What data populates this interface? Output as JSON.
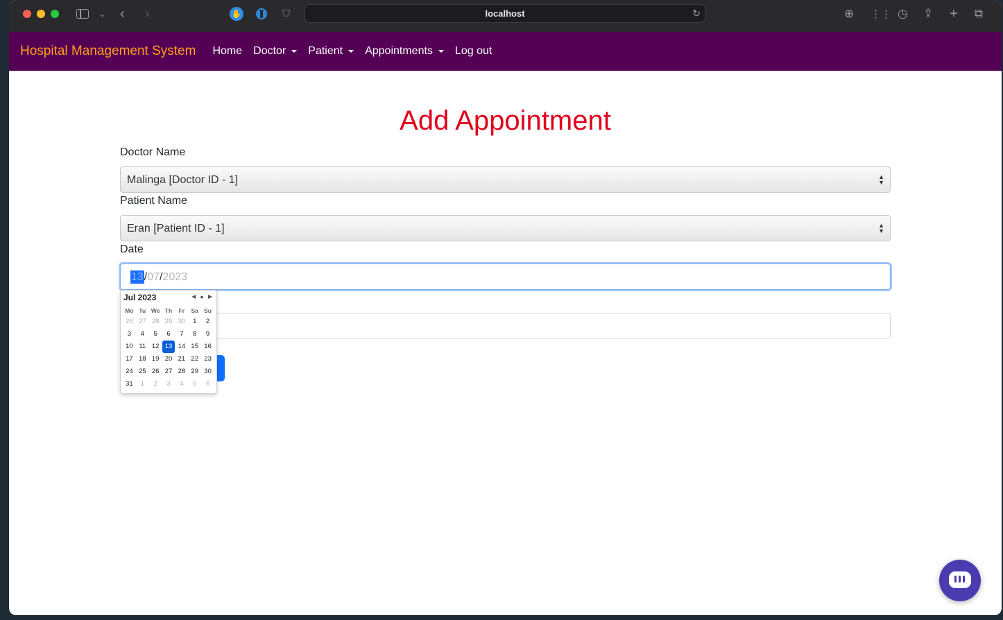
{
  "browser": {
    "url": "localhost"
  },
  "navbar": {
    "brand": "Hospital Management System",
    "items": [
      {
        "label": "Home"
      },
      {
        "label": "Doctor"
      },
      {
        "label": "Patient"
      },
      {
        "label": "Appointments"
      },
      {
        "label": "Log out"
      }
    ]
  },
  "form": {
    "title": "Add Appointment",
    "doctor_label": "Doctor Name",
    "doctor_value": "Malinga [Doctor ID - 1]",
    "patient_label": "Patient Name",
    "patient_value": "Eran [Patient ID - 1]",
    "date_label": "Date",
    "date_day": "13",
    "date_month": "07",
    "date_year": "2023",
    "date_separator": "/"
  },
  "calendar": {
    "month_label": "Jul 2023",
    "weekdays": [
      "Mo",
      "Tu",
      "We",
      "Th",
      "Fr",
      "Sa",
      "Su"
    ],
    "selected_day": "13",
    "leading_days": [
      "26",
      "27",
      "28",
      "29",
      "30"
    ],
    "month_days": [
      "1",
      "2",
      "3",
      "4",
      "5",
      "6",
      "7",
      "8",
      "9",
      "10",
      "11",
      "12",
      "13",
      "14",
      "15",
      "16",
      "17",
      "18",
      "19",
      "20",
      "21",
      "22",
      "23",
      "24",
      "25",
      "26",
      "27",
      "28",
      "29",
      "30",
      "31"
    ],
    "trailing_days": [
      "1",
      "2",
      "3",
      "4",
      "5",
      "6"
    ]
  },
  "colors": {
    "navbar_bg": "#540054",
    "brand": "#ff9e1b",
    "title": "#e0001b",
    "primary": "#0d6efd",
    "chat": "#4b3bb0"
  }
}
